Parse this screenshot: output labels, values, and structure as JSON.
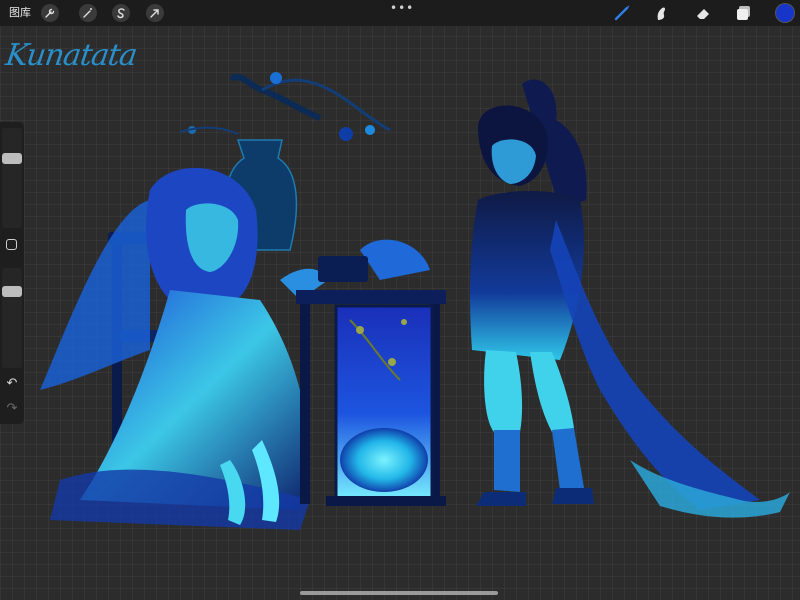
{
  "toolbar": {
    "gallery_label": "图库",
    "left_tools": [
      {
        "name": "actions",
        "icon": "wrench-icon"
      },
      {
        "name": "adjustments",
        "icon": "magic-wand-icon"
      },
      {
        "name": "selection",
        "icon": "selection-s-icon"
      },
      {
        "name": "transform",
        "icon": "arrow-cursor-icon"
      }
    ],
    "more_label": "•••",
    "right_tools": [
      {
        "name": "brush",
        "icon": "brush-icon"
      },
      {
        "name": "smudge",
        "icon": "smudge-finger-icon"
      },
      {
        "name": "eraser",
        "icon": "eraser-icon"
      },
      {
        "name": "layers",
        "icon": "layers-icon"
      }
    ],
    "current_color": "#1736c9"
  },
  "sidebar": {
    "brush_size_level": 0.28,
    "opacity_level": 0.2,
    "undo_icon": "undo-arrow-icon",
    "redo_icon": "redo-arrow-icon"
  },
  "canvas": {
    "signature_text": "Kunatata",
    "signature_color": "#2a8fc9",
    "palette": [
      "#0b1a4a",
      "#1a3fd0",
      "#26c9f0",
      "#5de8ff",
      "#0a0f2a"
    ]
  }
}
